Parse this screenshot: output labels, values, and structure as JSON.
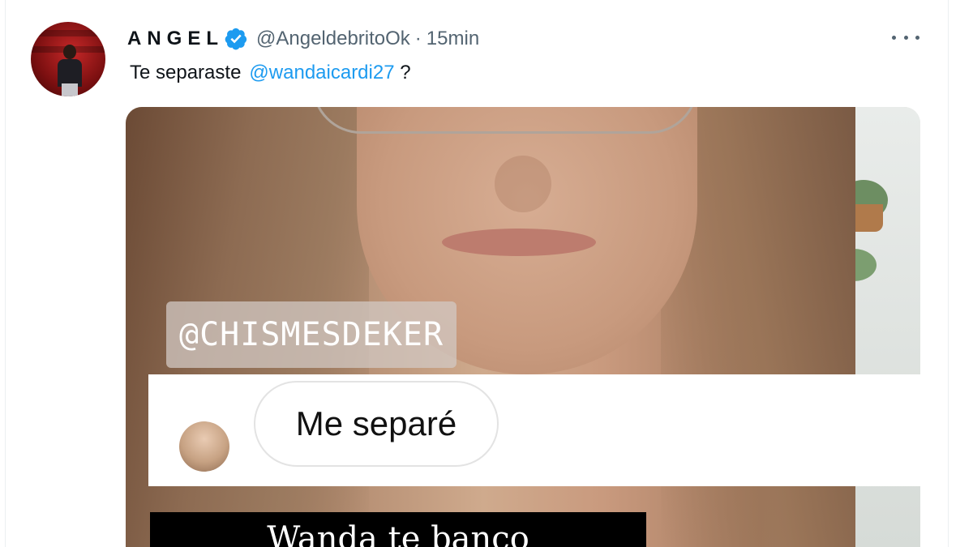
{
  "tweet": {
    "author_name": "ANGEL",
    "handle": "@AngeldebritoOk",
    "separator": "·",
    "time": "15min",
    "text": "Te separaste",
    "mention": "@wandaicardi27",
    "text_suffix": "?"
  },
  "icons": {
    "verified": "verified-badge-icon",
    "more": "more-options-icon",
    "accent": "#1d9bf0"
  },
  "media": {
    "tag_sticker": "@CHISMESDEKER",
    "reply_text": "Me separé",
    "caption": "Wanda te banco"
  }
}
